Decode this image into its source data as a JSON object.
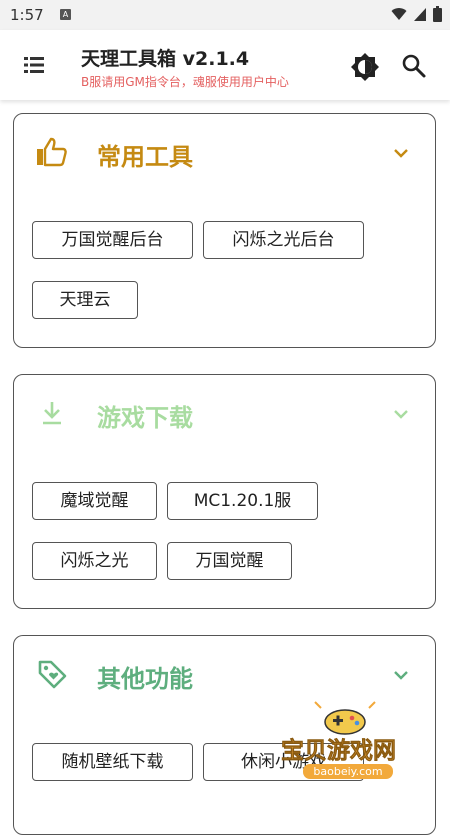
{
  "status_bar": {
    "time": "1:57",
    "notif_letter": "A"
  },
  "app_bar": {
    "title": "天理工具箱 v2.1.4",
    "subtitle": "B服请用GM指令台，魂服使用用户中心",
    "menu_icon": "menu-list-icon",
    "theme_icon": "brightness-icon",
    "search_icon": "search-icon"
  },
  "cards": [
    {
      "title": "常用工具",
      "color": "#c58a12",
      "icon": "thumbs-up-icon",
      "buttons": [
        "万国觉醒后台",
        "闪烁之光后台",
        "天理云"
      ]
    },
    {
      "title": "游戏下载",
      "color": "#a8dca0",
      "icon": "download-icon",
      "buttons": [
        "魔域觉醒",
        "MC1.20.1服",
        "闪烁之光",
        "万国觉醒"
      ]
    },
    {
      "title": "其他功能",
      "color": "#5eae7e",
      "icon": "tag-icon",
      "buttons": [
        "随机壁纸下载",
        "休闲小游戏"
      ]
    }
  ],
  "watermark": {
    "text": "宝贝游戏网",
    "url": "baobeiy.com"
  }
}
